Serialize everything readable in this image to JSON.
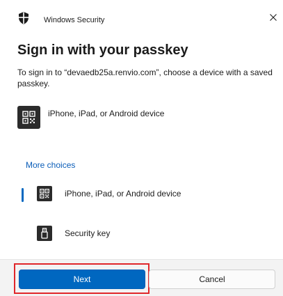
{
  "window": {
    "title": "Windows Security",
    "close_glyph": "✕"
  },
  "heading": "Sign in with your passkey",
  "description": "To sign in to “devaedb25a.renvio.com”, choose a device with a saved passkey.",
  "primary_device": {
    "label": "iPhone, iPad, or Android device",
    "icon": "qr-code-icon"
  },
  "more_choices_label": "More choices",
  "options": [
    {
      "label": "iPhone, iPad, or Android device",
      "icon": "qr-code-icon",
      "selected": true
    },
    {
      "label": "Security key",
      "icon": "usb-key-icon",
      "selected": false
    }
  ],
  "buttons": {
    "next_label": "Next",
    "cancel_label": "Cancel"
  },
  "colors": {
    "accent": "#0067c0",
    "link": "#0a5db8",
    "highlight": "#e0262a"
  }
}
